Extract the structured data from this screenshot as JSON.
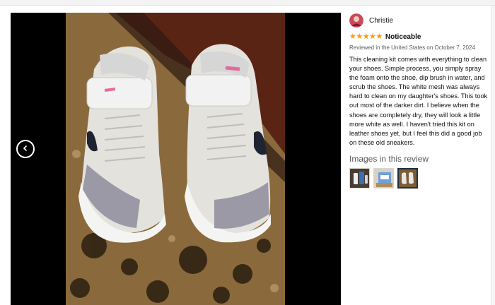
{
  "viewer": {
    "prev_icon": "chevron-left-icon",
    "photo_alt": "Photo of cleaned white and gray sneakers on a rug"
  },
  "review": {
    "reviewer_name": "Christie",
    "rating": 5,
    "star_icon": "star-icon",
    "title": "Noticeable",
    "meta": "Reviewed in the United States on October 7, 2024",
    "body": "This cleaning kit comes with everything to clean your shoes. Simple process, you simply spray the foam onto the shoe, dip brush in water, and scrub the shoes. The white mesh was always hard to clean on my daughter's shoes. This took out most of the darker dirt. I believe when the shoes are completely dry, they will look a little more white as well. I haven't tried this kit on leather shoes yet, but I feel this did a good job on these old sneakers.",
    "images_heading": "Images in this review",
    "thumbnails": [
      {
        "label": "Review image 1",
        "selected": false
      },
      {
        "label": "Review image 2",
        "selected": false
      },
      {
        "label": "Review image 3",
        "selected": true
      }
    ]
  },
  "colors": {
    "star": "#ff9900",
    "viewer_bg": "#000000",
    "selected_thumb_border": "#232f3e"
  }
}
